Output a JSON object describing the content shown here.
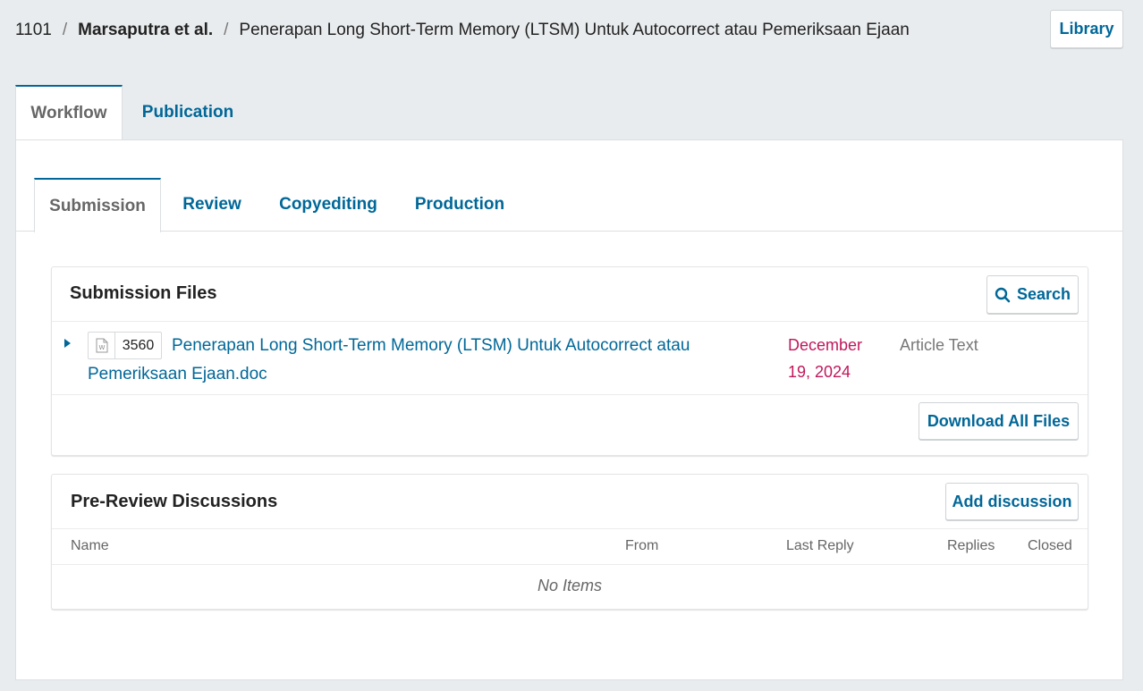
{
  "breadcrumb": {
    "id": "1101",
    "separator": "/",
    "author": "Marsaputra et al.",
    "title": "Penerapan Long Short-Term Memory (LTSM) Untuk Autocorrect atau Pemeriksaan Ejaan"
  },
  "header": {
    "library_label": "Library"
  },
  "top_tabs": [
    {
      "label": "Workflow",
      "active": true
    },
    {
      "label": "Publication",
      "active": false
    }
  ],
  "stage_tabs": [
    {
      "label": "Submission",
      "active": true
    },
    {
      "label": "Review",
      "active": false
    },
    {
      "label": "Copyediting",
      "active": false
    },
    {
      "label": "Production",
      "active": false
    }
  ],
  "submission_files": {
    "title": "Submission Files",
    "search_label": "Search",
    "files": [
      {
        "id": "3560",
        "icon": "word-doc-icon",
        "name": "Penerapan Long Short-Term Memory (LTSM) Untuk Autocorrect atau Pemeriksaan Ejaan.doc",
        "date": "December 19, 2024",
        "type": "Article Text"
      }
    ],
    "download_all_label": "Download All Files"
  },
  "discussions": {
    "title": "Pre-Review Discussions",
    "add_label": "Add discussion",
    "columns": [
      "Name",
      "From",
      "Last Reply",
      "Replies",
      "Closed"
    ],
    "empty_text": "No Items"
  },
  "colors": {
    "accent": "#006798",
    "date": "#c0175b",
    "background": "#e9ecee"
  }
}
